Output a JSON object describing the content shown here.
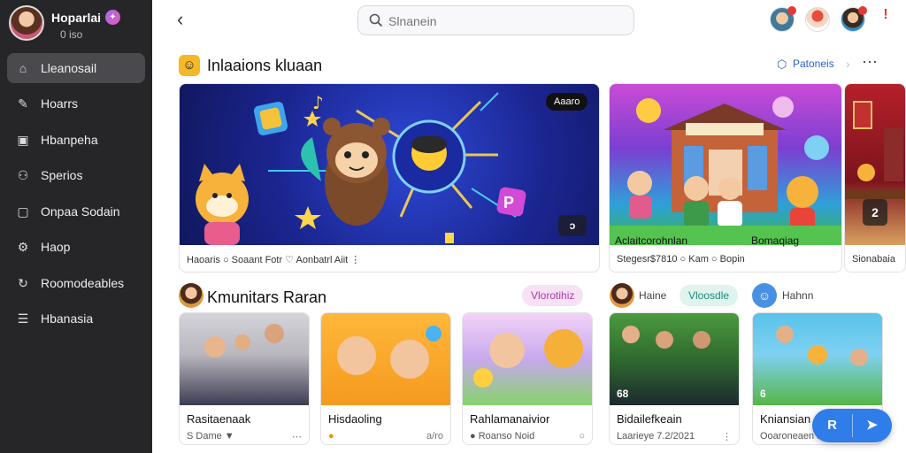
{
  "profile": {
    "name": "Hoparlai",
    "sub": "0 iso",
    "badge_icon": "sparkle-badge"
  },
  "sidebar": {
    "items": [
      {
        "label": "Lleanosail",
        "icon": "home-icon",
        "active": true
      },
      {
        "label": "Hoarrs",
        "icon": "wrench-icon",
        "active": false
      },
      {
        "label": "Hbanpeha",
        "icon": "house-icon",
        "active": false
      },
      {
        "label": "Sperios",
        "icon": "people-icon",
        "active": false
      },
      {
        "label": "Onpaa Sodain",
        "icon": "square-icon",
        "active": false
      },
      {
        "label": "Haop",
        "icon": "gear-icon",
        "active": false
      },
      {
        "label": "Roomodeables",
        "icon": "refresh-icon",
        "active": false
      },
      {
        "label": "Hbanasia",
        "icon": "list-icon",
        "active": false
      }
    ]
  },
  "header": {
    "search_placeholder": "Slnanein"
  },
  "featured": {
    "title": "Inlaaions kluaan",
    "link_label": "Patoneis",
    "cards": [
      {
        "tag": "Aaaro",
        "counter": "ↄ",
        "caption": "Haoaris   ○ Soaant Fotr   ♡ Aonbatrl Aiit   ⋮"
      },
      {
        "title": "Aclaitcorohnlan",
        "title2": "Bomaqiag",
        "caption": "Stegesr$7810   ○ Kam   ○ Bopin"
      },
      {
        "counter": "2",
        "caption": "Sionabaia"
      }
    ]
  },
  "community": {
    "title": "Kmunitars Raran",
    "chips": {
      "pink": "Vlorotihiz",
      "teal": "Vloosdle"
    },
    "users": [
      {
        "label": "Haine"
      },
      {
        "label": "Hahnn"
      }
    ],
    "cards": [
      {
        "title": "Rasitaenaak",
        "meta": "S Dame ▼",
        "side": "⋯"
      },
      {
        "title": "Hisdaoling",
        "meta": "●",
        "side": "a/ro"
      },
      {
        "title": "Rahlamanaivior",
        "meta": "● Roanso Noid",
        "side": "○"
      },
      {
        "title": "Bidailefkeain",
        "meta": "Laarieye 7.2/2021",
        "side": "⋮",
        "duration": "68"
      },
      {
        "title": "Kniansian",
        "meta": "Ooaroneaen Hoaseh",
        "duration": "6"
      }
    ]
  },
  "fab": {
    "left": "R",
    "right": "➤"
  },
  "colors": {
    "accent": "#2f7de8",
    "sidebar_bg": "#262628",
    "active_nav": "#4a4a4e",
    "link": "#2b5fc9"
  }
}
